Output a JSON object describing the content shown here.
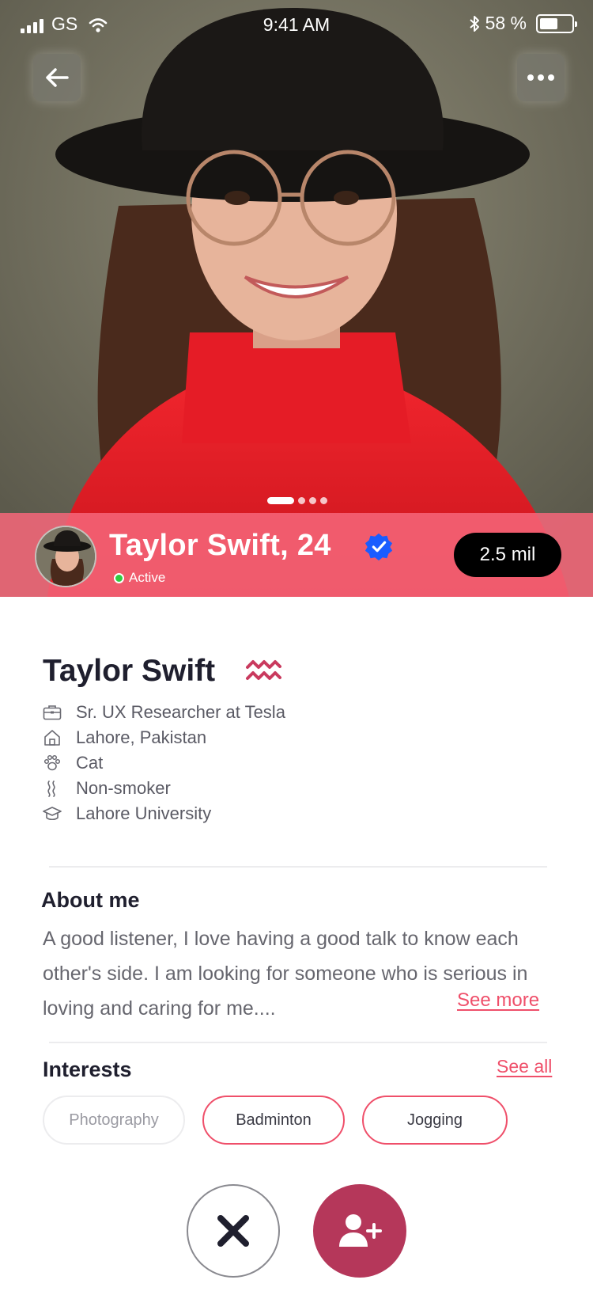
{
  "status_bar": {
    "carrier": "GS",
    "time": "9:41 AM",
    "battery": "58 %",
    "battery_level": 0.58
  },
  "hero": {
    "photo_count": 4,
    "active_photo": 1
  },
  "profile_band": {
    "name_age": "Taylor Swift, 24",
    "status": "Active",
    "followers": "2.5 mil"
  },
  "profile": {
    "name": "Taylor Swift",
    "zodiac_icon": "aquarius-icon",
    "details": [
      {
        "icon": "briefcase-icon",
        "text": "Sr. UX Researcher at Tesla"
      },
      {
        "icon": "home-icon",
        "text": "Lahore, Pakistan"
      },
      {
        "icon": "paw-icon",
        "text": "Cat"
      },
      {
        "icon": "smoke-icon",
        "text": "Non-smoker"
      },
      {
        "icon": "graduation-cap-icon",
        "text": "Lahore University"
      }
    ]
  },
  "about": {
    "title": "About me",
    "text": "A good listener, I love having a good talk to know each other's side. I am looking for someone who is serious in loving and caring for me....",
    "see_more": "See more"
  },
  "interests": {
    "title": "Interests",
    "see_all": "See all",
    "items": [
      "Photography",
      "Badminton",
      "Jogging"
    ]
  },
  "colors": {
    "accent": "#ef4f6a",
    "band": "#f6667a",
    "add_button": "#b5375a",
    "verified": "#1a5cff"
  }
}
